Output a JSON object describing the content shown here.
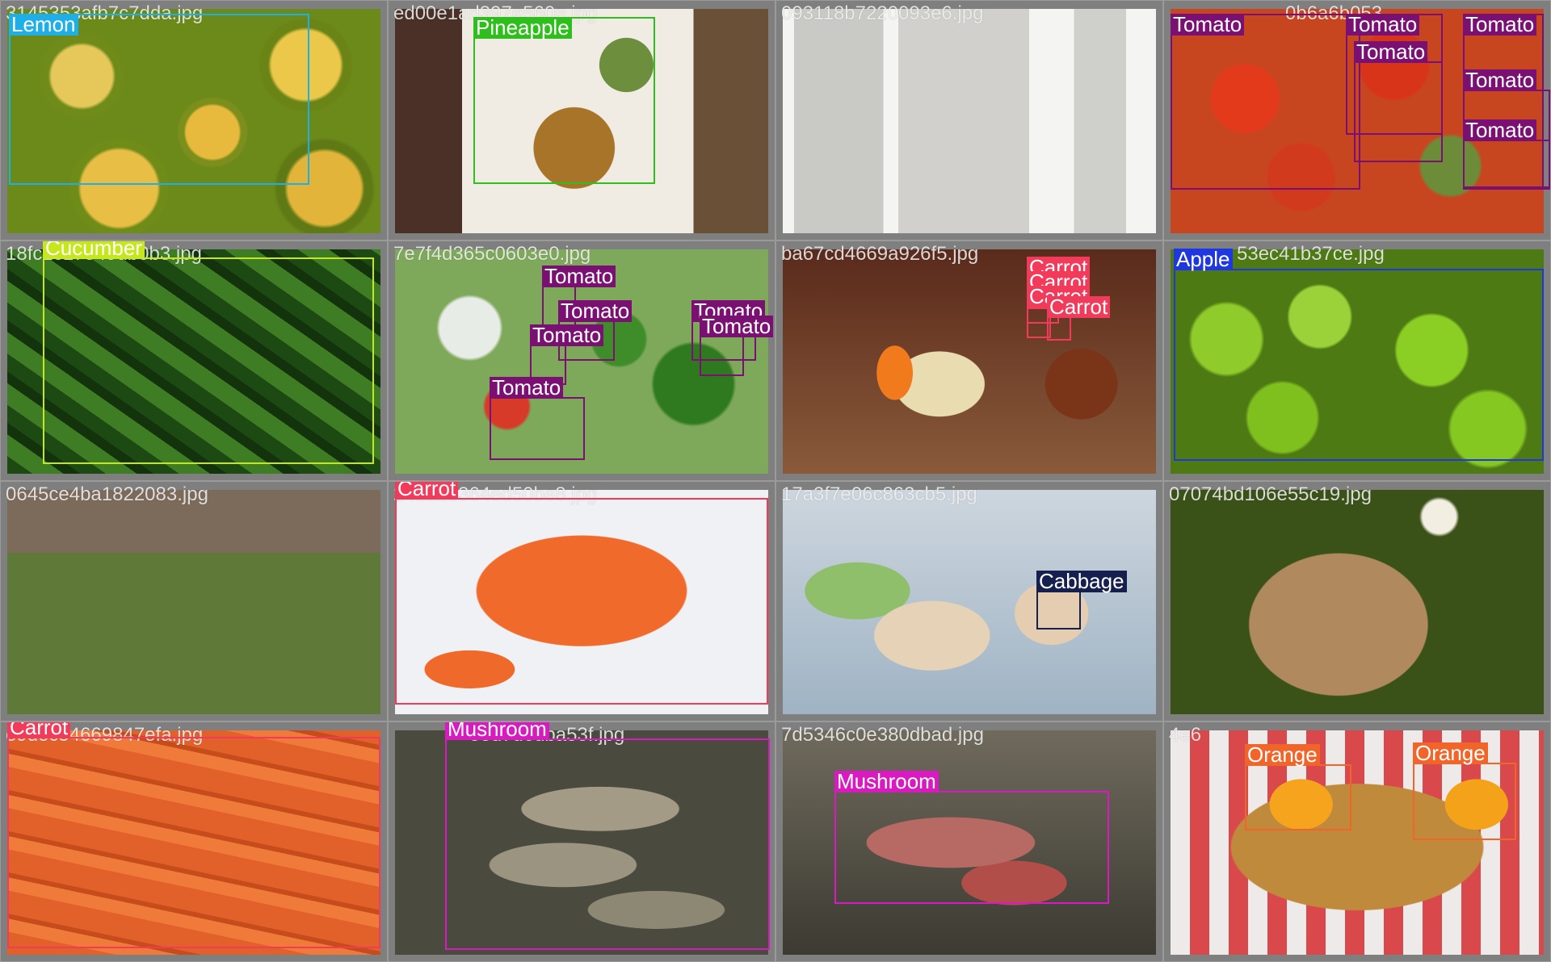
{
  "grid": {
    "tiles": [
      {
        "filename": "3145353afb7c7dda.jpg",
        "boxes": [
          {
            "label": "Lemon",
            "color": "#1eaee8"
          }
        ]
      },
      {
        "filename": "ed00e1ad397e560e.jpg",
        "boxes": [
          {
            "label": "Pineapple",
            "color": "#2fbf1d"
          }
        ]
      },
      {
        "filename": "093118b7220093e6.jpg",
        "boxes": []
      },
      {
        "filename": "0b6a6b053",
        "boxes": [
          {
            "label": "Tomato",
            "color": "#7b1073"
          },
          {
            "label": "Tomato",
            "color": "#7b1073"
          },
          {
            "label": "Tomato",
            "color": "#7b1073"
          },
          {
            "label": "Tomato",
            "color": "#7b1073"
          },
          {
            "label": "Tomato",
            "color": "#7b1073"
          },
          {
            "label": "Tomato",
            "color": "#7b1073"
          }
        ]
      },
      {
        "filename": "18fc2c17349db0b3.jpg",
        "boxes": [
          {
            "label": "Cucumber",
            "color": "#c6e81a"
          }
        ]
      },
      {
        "filename": "7e7f4d365c0603e0.jpg",
        "boxes": [
          {
            "label": "Tomato",
            "color": "#7b1073"
          },
          {
            "label": "Tomato",
            "color": "#7b1073"
          },
          {
            "label": "Tomato",
            "color": "#7b1073"
          },
          {
            "label": "Tomato",
            "color": "#7b1073"
          },
          {
            "label": "Tomato",
            "color": "#7b1073"
          },
          {
            "label": "Tomato",
            "color": "#7b1073"
          }
        ]
      },
      {
        "filename": "ba67cd4669a926f5.jpg",
        "boxes": [
          {
            "label": "Carrot",
            "color": "#f23a5a"
          },
          {
            "label": "Carrot",
            "color": "#f23a5a"
          },
          {
            "label": "Carrot",
            "color": "#f23a5a"
          },
          {
            "label": "Carrot",
            "color": "#f23a5a"
          }
        ]
      },
      {
        "filename": "53ec41b37ce.jpg",
        "boxes": [
          {
            "label": "Apple",
            "color": "#1e37e0"
          }
        ]
      },
      {
        "filename": "0645ce4ba1822083.jpg",
        "boxes": []
      },
      {
        "filename": "241225364ed50be8.jpg",
        "boxes": [
          {
            "label": "Carrot",
            "color": "#f23a5a"
          }
        ]
      },
      {
        "filename": "17a3f7e06c863cb5.jpg",
        "boxes": [
          {
            "label": "Cabbage",
            "color": "#16204f"
          }
        ]
      },
      {
        "filename": "07074bd106e55c19.jpg",
        "boxes": []
      },
      {
        "filename": "e9dec54669847efa.jpg",
        "boxes": [
          {
            "label": "Carrot",
            "color": "#f23a5a"
          }
        ]
      },
      {
        "filename": "3ed7d6dba53f.jpg",
        "boxes": [
          {
            "label": "Mushroom",
            "color": "#d81ac0"
          }
        ]
      },
      {
        "filename": "7d5346c0e380dbad.jpg",
        "boxes": [
          {
            "label": "Mushroom",
            "color": "#d81ac0"
          }
        ]
      },
      {
        "filename": "4e6",
        "boxes": [
          {
            "label": "Orange",
            "color": "#f2652a"
          },
          {
            "label": "Orange",
            "color": "#f2652a"
          }
        ]
      }
    ]
  }
}
